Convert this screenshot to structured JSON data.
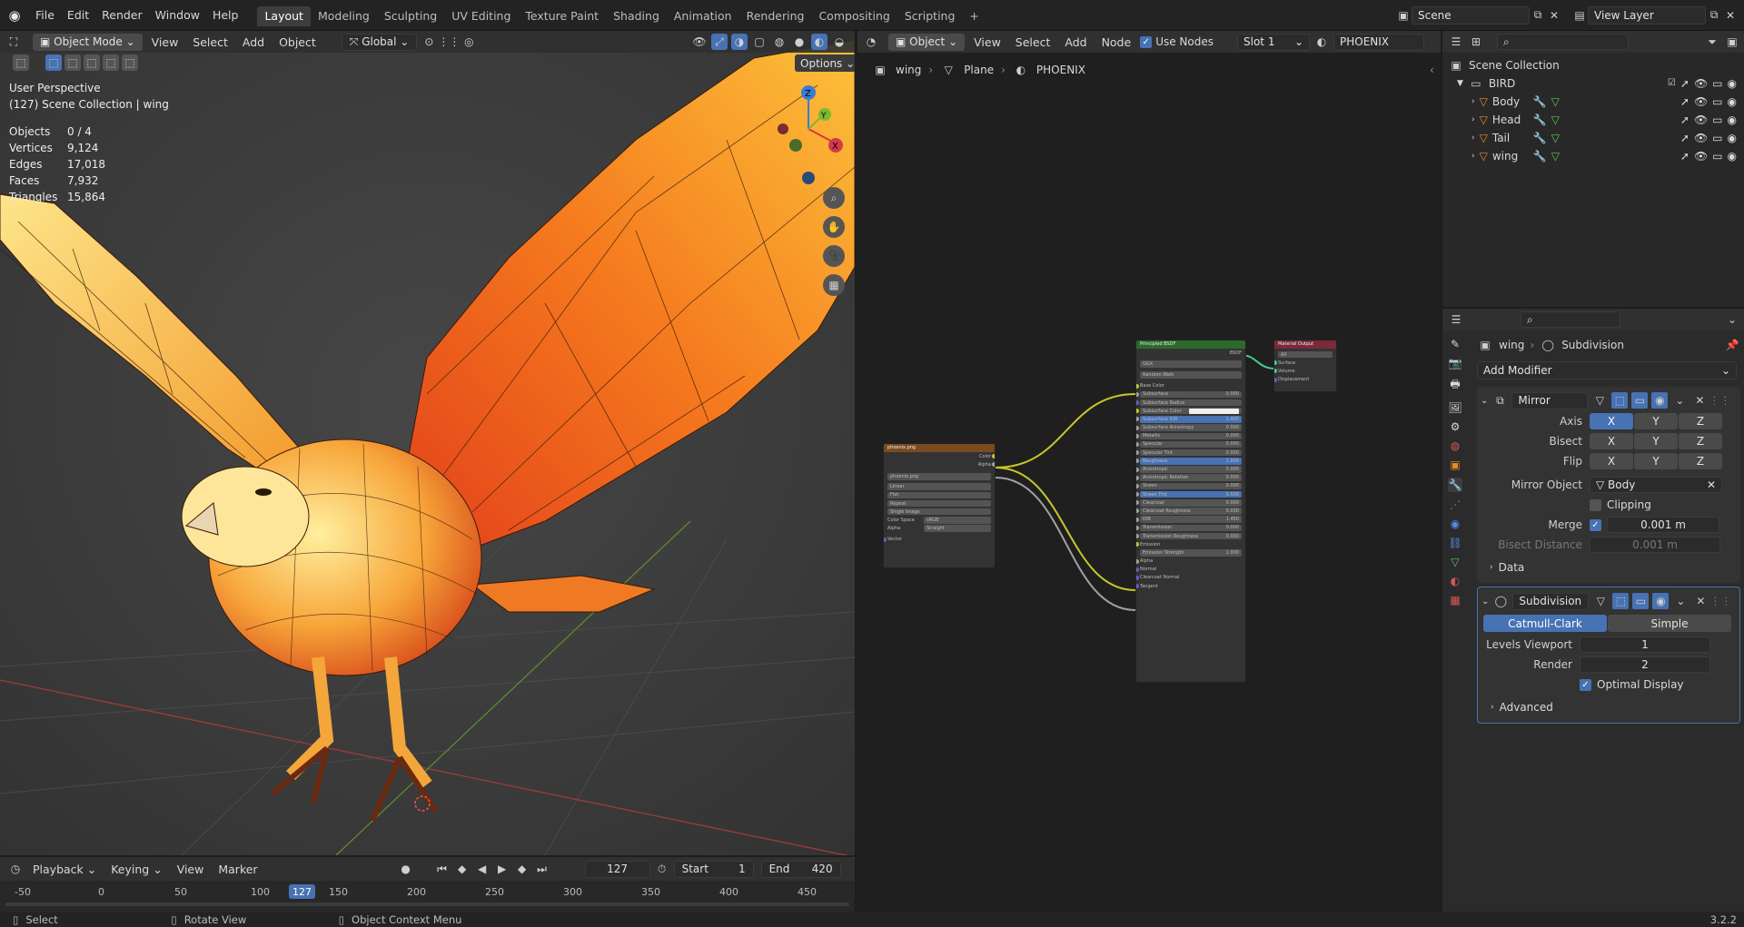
{
  "topbar": {
    "menus": [
      "File",
      "Edit",
      "Render",
      "Window",
      "Help"
    ],
    "workspaces": [
      "Layout",
      "Modeling",
      "Sculpting",
      "UV Editing",
      "Texture Paint",
      "Shading",
      "Animation",
      "Rendering",
      "Compositing",
      "Scripting"
    ],
    "active_workspace": "Layout",
    "add_tab": "+",
    "scene": "Scene",
    "view_layer": "View Layer"
  },
  "viewport": {
    "mode": "Object Mode",
    "menus": [
      "View",
      "Select",
      "Add",
      "Object"
    ],
    "orientation": "Global",
    "options": "Options",
    "perspective": "User Perspective",
    "collection_line": "(127) Scene Collection | wing",
    "stats": [
      {
        "label": "Objects",
        "value": "0 / 4"
      },
      {
        "label": "Vertices",
        "value": "9,124"
      },
      {
        "label": "Edges",
        "value": "17,018"
      },
      {
        "label": "Faces",
        "value": "7,932"
      },
      {
        "label": "Triangles",
        "value": "15,864"
      }
    ],
    "gizmo": {
      "x": "X",
      "y": "Y",
      "z": "Z"
    }
  },
  "timeline": {
    "menus": [
      "Playback",
      "Keying",
      "View",
      "Marker"
    ],
    "current_frame": "127",
    "start_label": "Start",
    "start": "1",
    "end_label": "End",
    "end": "420",
    "ticks": [
      "-50",
      "0",
      "50",
      "100",
      "150",
      "200",
      "250",
      "300",
      "350",
      "400",
      "450"
    ]
  },
  "node_editor": {
    "object_type": "Object",
    "menus": [
      "View",
      "Select",
      "Add",
      "Node"
    ],
    "use_nodes_label": "Use Nodes",
    "use_nodes": true,
    "slot": "Slot 1",
    "material": "PHOENIX",
    "breadcrumb": [
      "wing",
      "Plane",
      "PHOENIX"
    ],
    "image_node": {
      "title": "phoenix.png",
      "outputs": [
        "Color",
        "Alpha"
      ],
      "image": "phoenix.png",
      "fields": [
        "Linear",
        "Flat",
        "Repeat",
        "Single Image"
      ],
      "color_space_label": "Color Space",
      "color_space": "sRGB",
      "alpha_label": "Alpha",
      "alpha": "Straight",
      "input": "Vector"
    },
    "bsdf_node": {
      "title": "Principled BSDF",
      "output": "BSDF",
      "dropdowns": [
        "GGX",
        "Random Walk"
      ],
      "base_color": "Base Color",
      "rows": [
        {
          "label": "Subsurface",
          "value": "0.000"
        },
        {
          "label": "Subsurface Radius",
          "value": ""
        },
        {
          "label": "Subsurface Color",
          "value": ""
        },
        {
          "label": "Subsurface IOR",
          "value": "1.400"
        },
        {
          "label": "Subsurface Anisotropy",
          "value": "0.000"
        },
        {
          "label": "Metallic",
          "value": "0.000"
        },
        {
          "label": "Specular",
          "value": "0.000"
        },
        {
          "label": "Specular Tint",
          "value": "0.000"
        },
        {
          "label": "Roughness",
          "value": "1.000"
        },
        {
          "label": "Anisotropic",
          "value": "0.000"
        },
        {
          "label": "Anisotropic Rotation",
          "value": "0.000"
        },
        {
          "label": "Sheen",
          "value": "0.000"
        },
        {
          "label": "Sheen Tint",
          "value": "0.500"
        },
        {
          "label": "Clearcoat",
          "value": "0.000"
        },
        {
          "label": "Clearcoat Roughness",
          "value": "0.030"
        },
        {
          "label": "IOR",
          "value": "1.450"
        },
        {
          "label": "Transmission",
          "value": "0.000"
        },
        {
          "label": "Transmission Roughness",
          "value": "0.000"
        }
      ],
      "emission": "Emission",
      "emission_strength": {
        "label": "Emission Strength",
        "value": "1.000"
      },
      "tail": [
        "Alpha",
        "Normal",
        "Clearcoat Normal",
        "Tangent"
      ]
    },
    "output_node": {
      "title": "Material Output",
      "target": "All",
      "inputs": [
        "Surface",
        "Volume",
        "Displacement"
      ]
    }
  },
  "outliner": {
    "root": "Scene Collection",
    "collection": "BIRD",
    "items": [
      "Body",
      "Head",
      "Tail",
      "wing"
    ]
  },
  "properties": {
    "breadcrumb": [
      "wing",
      "Subdivision"
    ],
    "add_modifier": "Add Modifier",
    "mirror": {
      "name": "Mirror",
      "axis_label": "Axis",
      "bisect_label": "Bisect",
      "flip_label": "Flip",
      "xyz": [
        "X",
        "Y",
        "Z"
      ],
      "mirror_object_label": "Mirror Object",
      "mirror_object": "Body",
      "clipping_label": "Clipping",
      "merge_label": "Merge",
      "merge": "0.001 m",
      "bisect_distance_label": "Bisect Distance",
      "bisect_distance": "0.001 m",
      "data_label": "Data"
    },
    "subdivision": {
      "name": "Subdivision",
      "algorithms": [
        "Catmull-Clark",
        "Simple"
      ],
      "levels_viewport_label": "Levels Viewport",
      "levels_viewport": "1",
      "render_label": "Render",
      "render": "2",
      "optimal_display_label": "Optimal Display",
      "advanced_label": "Advanced"
    }
  },
  "statusbar": {
    "select": "Select",
    "rotate": "Rotate View",
    "context": "Object Context Menu",
    "version": "3.2.2"
  }
}
